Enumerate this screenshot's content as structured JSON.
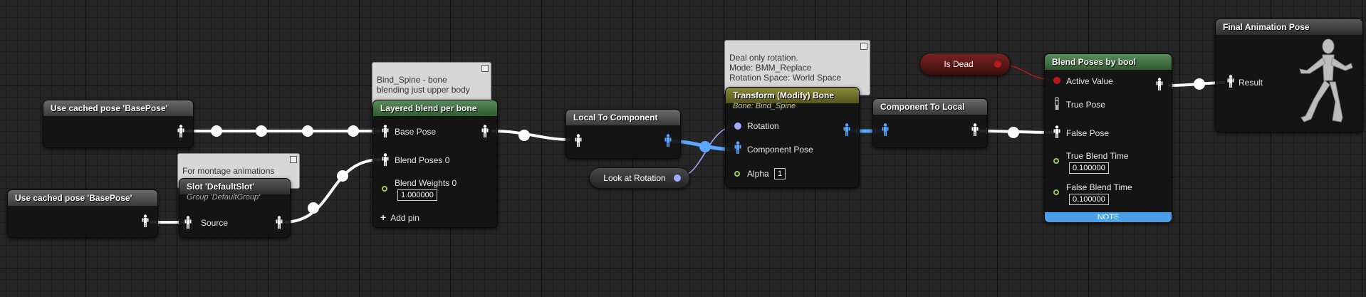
{
  "nodes": {
    "cached_pose_top": {
      "title": "Use cached pose 'BasePose'"
    },
    "cached_pose_bottom": {
      "title": "Use cached pose 'BasePose'"
    },
    "slot": {
      "title": "Slot 'DefaultSlot'",
      "subtitle": "Group 'DefaultGroup'",
      "pin_source": "Source"
    },
    "layered_blend": {
      "title": "Layered blend per bone",
      "pin_base_pose": "Base Pose",
      "pin_blend_poses": "Blend Poses 0",
      "pin_blend_weights": "Blend Weights 0",
      "blend_weights_value": "1.000000",
      "add_pin": "Add pin"
    },
    "local_to_component": {
      "title": "Local To Component"
    },
    "look_at_rotation": {
      "title": "Look at Rotation"
    },
    "transform_bone": {
      "title": "Transform (Modify) Bone",
      "subtitle": "Bone: Bind_Spine",
      "pin_rotation": "Rotation",
      "pin_component_pose": "Component Pose",
      "pin_alpha": "Alpha",
      "alpha_value": "1"
    },
    "component_to_local": {
      "title": "Component To Local"
    },
    "is_dead": {
      "title": "Is Dead"
    },
    "blend_poses_bool": {
      "title": "Blend Poses by bool",
      "pin_active_value": "Active Value",
      "pin_true_pose": "True Pose",
      "pin_false_pose": "False Pose",
      "pin_true_blend_time": "True Blend Time",
      "true_blend_time_value": "0.100000",
      "pin_false_blend_time": "False Blend Time",
      "false_blend_time_value": "0.100000",
      "note": "NOTE"
    },
    "final_pose": {
      "title": "Final Animation Pose",
      "pin_result": "Result"
    }
  },
  "comments": {
    "layered_blend": "Bind_Spine   - bone\nblending just upper body",
    "slot": "For montage animations",
    "transform_bone": "Deal only rotation.\nMode: BMM_Replace\nRotation Space: World Space"
  },
  "colors": {
    "pose_wire": "#ffffff",
    "component_wire": "#5aa8ff",
    "bool_pin": "#b81818",
    "float_pin": "#9ac850",
    "rotator_pin": "#a0a8ff",
    "note_bar": "#4aa0e8"
  },
  "icons": {
    "pose": "pose-figure-icon",
    "add": "plus-icon",
    "mannequin": "mannequin-running-icon"
  }
}
